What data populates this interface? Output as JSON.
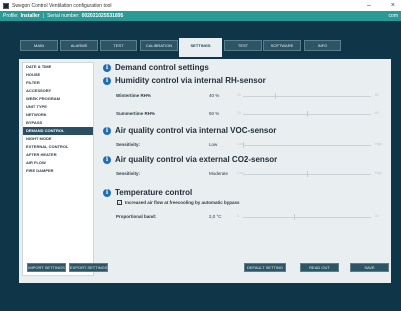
{
  "window": {
    "title": "Swegon Control Ventilation configuration tool",
    "minimize": "–",
    "close": "×"
  },
  "profile": {
    "label": "Profile:",
    "value": "Installer",
    "separator": "|",
    "serial_label": "Serial number:",
    "serial_value": "002021025531895",
    "right": "com"
  },
  "tabs": [
    {
      "label": "Main",
      "active": false
    },
    {
      "label": "Alarms",
      "active": false
    },
    {
      "label": "Test",
      "active": false
    },
    {
      "label": "Calibration",
      "active": false
    },
    {
      "label": "Settings",
      "active": true
    },
    {
      "label": "Test",
      "active": false
    },
    {
      "label": "Software",
      "active": false
    },
    {
      "label": "Info",
      "active": false
    }
  ],
  "sidemenu": [
    {
      "label": "Date & time",
      "active": false
    },
    {
      "label": "House",
      "active": false
    },
    {
      "label": "Filter",
      "active": false
    },
    {
      "label": "Accessory",
      "active": false
    },
    {
      "label": "Week program",
      "active": false
    },
    {
      "label": "Unit type",
      "active": false
    },
    {
      "label": "Network",
      "active": false
    },
    {
      "label": "Bypass",
      "active": false
    },
    {
      "label": "Demand control",
      "active": true
    },
    {
      "label": "Night mode",
      "active": false
    },
    {
      "label": "External control",
      "active": false
    },
    {
      "label": "After heater",
      "active": false
    },
    {
      "label": "Air flow",
      "active": false
    },
    {
      "label": "Fire damper",
      "active": false
    }
  ],
  "demand": {
    "title": "Demand control settings",
    "humidity": {
      "title": "Humidity control via internal RH-sensor",
      "winter_label": "Wintertime RH%",
      "winter_value": "40 %",
      "winter_level": 0.25,
      "summer_label": "Summertime RH%",
      "summer_value": "50 %",
      "summer_level": 0.5,
      "range_min": "20",
      "range_max": "80"
    },
    "voc": {
      "title": "Air quality control via internal VOC-sensor",
      "label": "Sensitivity:",
      "value": "Low",
      "level": 0.0,
      "range_min": "Low",
      "range_max": "High"
    },
    "co2": {
      "title": "Air quality control via external CO2-sensor",
      "label": "Sensitivity:",
      "value": "Moderate",
      "level": 0.5,
      "range_min": "Low",
      "range_max": "High"
    },
    "temperature": {
      "title": "Temperature control",
      "checkbox_label": "Increased air flow at freecooling by automatic bypass",
      "checked": true,
      "band_label": "Proportional band:",
      "band_value": "2,0 °C",
      "band_level": 0.4,
      "range_min": "0",
      "range_max": "10"
    }
  },
  "buttons": {
    "import": "Import settings",
    "export": "Export settings",
    "default": "Default setting",
    "readout": "Read out",
    "save": "Save"
  },
  "icons": {
    "info": "i",
    "check": "✓"
  },
  "colors": {
    "profile_bar": "#2a9a97",
    "navy": "#0f3648",
    "panel": "#e9eef1",
    "active_menu": "#2a4f63",
    "info_icon": "#1f6eb5"
  }
}
